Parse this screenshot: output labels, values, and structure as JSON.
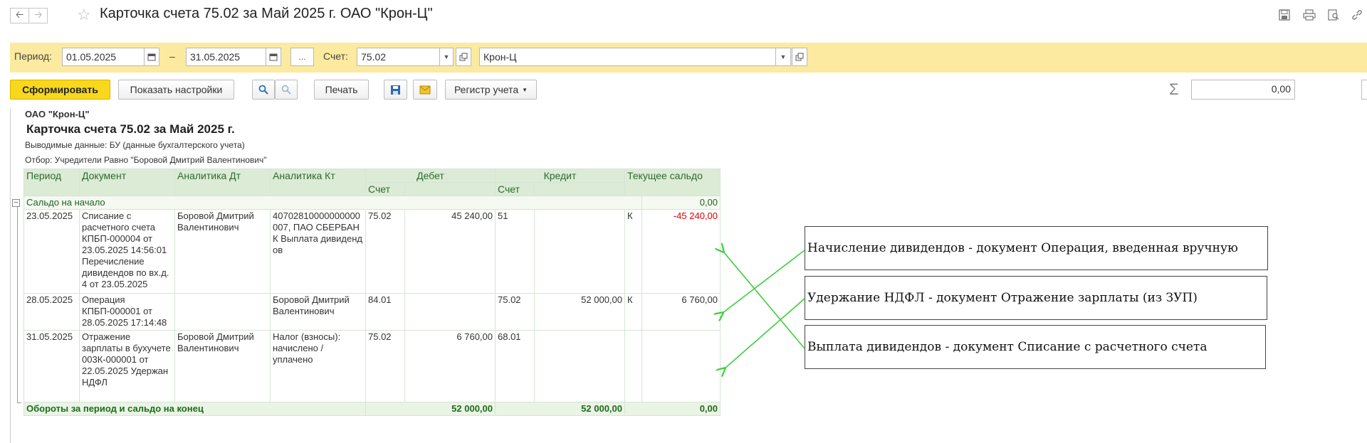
{
  "window": {
    "title": "Карточка счета 75.02 за Май 2025 г. ОАО \"Крон-Ц\""
  },
  "filters": {
    "period_label": "Период:",
    "date_from": "01.05.2025",
    "dash": "–",
    "date_to": "31.05.2025",
    "ellipsis": "...",
    "account_label": "Счет:",
    "account_value": "75.02",
    "org_value": "Крон-Ц"
  },
  "toolbar": {
    "generate": "Сформировать",
    "show_settings": "Показать настройки",
    "print": "Печать",
    "register": "Регистр учета",
    "sum_symbol": "Σ",
    "sum_value": "0,00"
  },
  "report": {
    "org": "ОАО \"Крон-Ц\"",
    "title": "Карточка счета 75.02 за Май 2025 г.",
    "output_data": "Выводимые данные: БУ (данные бухгалтерского учета)",
    "selection": "Отбор: Учредители Равно \"Боровой Дмитрий Валентинович\"",
    "headers": {
      "period": "Период",
      "document": "Документ",
      "analytics_dt": "Аналитика Дт",
      "analytics_kt": "Аналитика Кт",
      "debit": "Дебет",
      "credit": "Кредит",
      "balance": "Текущее сальдо",
      "account": "Счет"
    },
    "opening": {
      "label": "Сальдо на начало",
      "value": "0,00"
    },
    "rows": [
      {
        "period": "23.05.2025",
        "document": "Списание с расчетного счета КПБП-000004 от 23.05.2025 14:56:01 Перечисление дивидендов по вх.д. 4 от 23.05.2025",
        "analytics_dt": "Боровой Дмитрий Валентинович",
        "analytics_kt": "40702810000000000007, ПАО СБЕРБАНК Выплата дивидендов",
        "debit_account": "75.02",
        "debit_sum": "45 240,00",
        "credit_account": "51",
        "credit_sum": "",
        "balance_side": "К",
        "balance_value": "-45 240,00"
      },
      {
        "period": "28.05.2025",
        "document": "Операция КПБП-000001 от 28.05.2025 17:14:48",
        "analytics_dt": "",
        "analytics_kt": "Боровой Дмитрий Валентинович",
        "debit_account": "84.01",
        "debit_sum": "",
        "credit_account": "75.02",
        "credit_sum": "52 000,00",
        "balance_side": "К",
        "balance_value": "6 760,00"
      },
      {
        "period": "31.05.2025",
        "document": "Отражение зарплаты в бухучете 003К-000001 от 22.05.2025 Удержан НДФЛ",
        "analytics_dt": "Боровой Дмитрий Валентинович",
        "analytics_kt": "Налог (взносы): начислено / уплачено",
        "debit_account": "75.02",
        "debit_sum": "6 760,00",
        "credit_account": "68.01",
        "credit_sum": "",
        "balance_side": "",
        "balance_value": ""
      }
    ],
    "totals": {
      "label": "Обороты за период и сальдо на конец",
      "debit": "52 000,00",
      "credit": "52 000,00",
      "balance": "0,00"
    }
  },
  "annotations": [
    "Начисление дивидендов - документ Операция, введенная вручную",
    "Удержание НДФЛ - документ Отражение зарплаты (из ЗУП)",
    "Выплата дивидендов - документ Списание с расчетного счета"
  ],
  "colors": {
    "filter_bar": "#fbeaa0",
    "primary_button": "#f9d71c",
    "table_header": "#dcebd6",
    "negative": "#e00000",
    "arrows": "#3ccf3c"
  },
  "icons": [
    "back-arrow-icon",
    "forward-arrow-icon",
    "star-icon",
    "save-icon",
    "print-icon",
    "preview-icon",
    "link-icon",
    "calendar-icon",
    "dropdown-icon",
    "open-icon",
    "search-icon",
    "search-cancel-icon",
    "floppy-icon",
    "envelope-icon",
    "sum-icon",
    "collapse-icon"
  ]
}
